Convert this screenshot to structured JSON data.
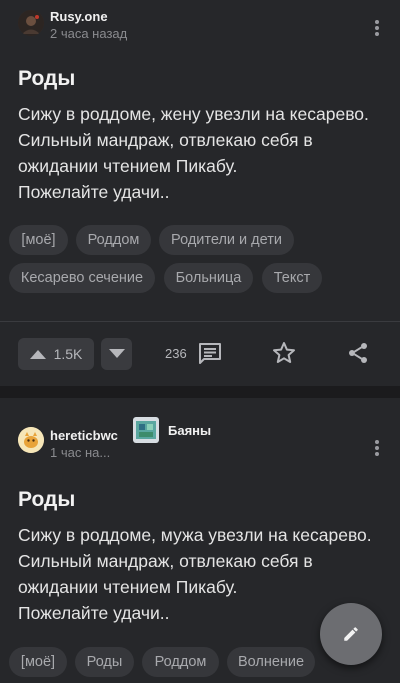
{
  "posts": [
    {
      "author": "Rusy.one",
      "time": "2 часа назад",
      "title": "Роды",
      "body": [
        "Сижу в роддоме, жену увезли на кесарево.",
        "Сильный мандраж, отвлекаю себя в",
        "ожидании чтением Пикабу.",
        "Пожелайте удачи.."
      ],
      "tags": [
        "[моё]",
        "Роддом",
        "Родители и дети",
        "Кесарево сечение",
        "Больница",
        "Текст"
      ],
      "rating": "1.5K",
      "comments": "236"
    },
    {
      "author": "hereticbwc",
      "time": "1 час на...",
      "community": "Баяны",
      "title": "Роды",
      "body": [
        "Сижу в роддоме, мужа увезли на кесарево.",
        "Сильный мандраж, отвлекаю себя в",
        "ожидании чтением Пикабу.",
        "Пожелайте удачи.."
      ],
      "tags": [
        "[моё]",
        "Роды",
        "Роддом",
        "Волнение"
      ]
    }
  ],
  "colors": {
    "background": "#1b1b1d",
    "card": "#26272a",
    "tag_bg": "#36373b",
    "fab": "#6c6d71"
  }
}
